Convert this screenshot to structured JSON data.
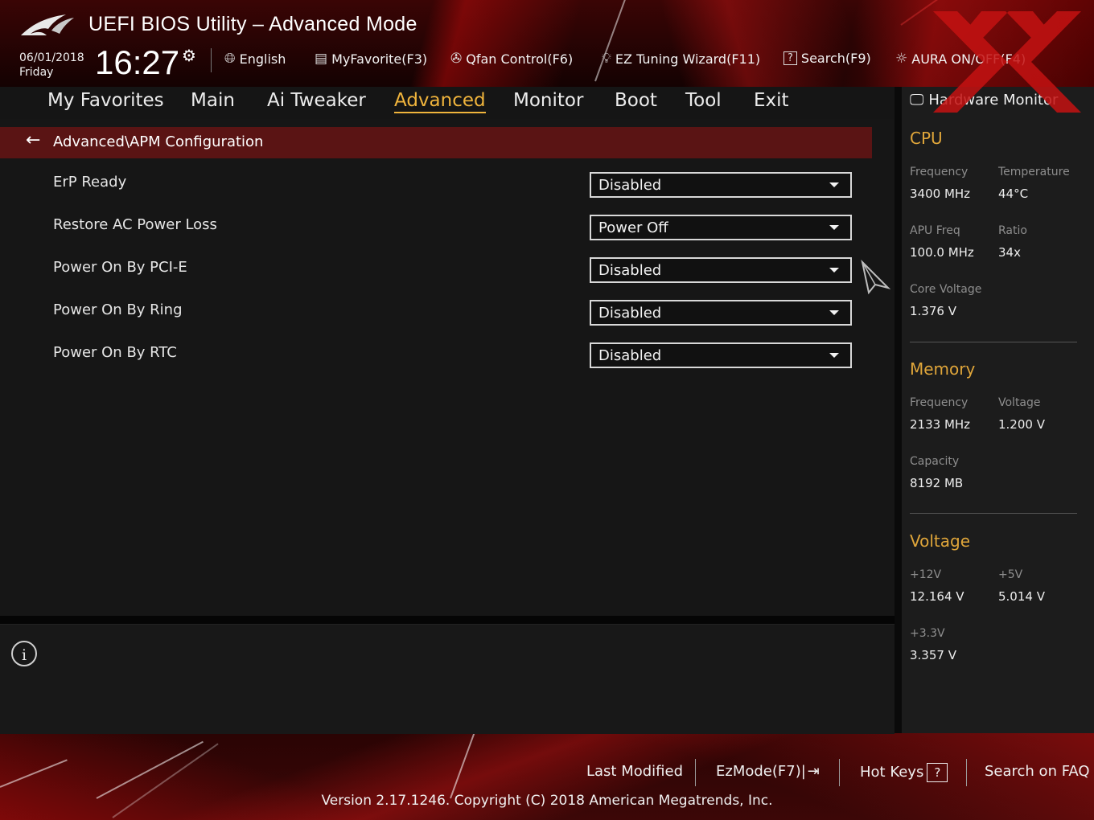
{
  "header": {
    "title": "UEFI BIOS Utility – Advanced Mode",
    "date": "06/01/2018",
    "day": "Friday",
    "time": "16:27",
    "tools": [
      {
        "icon": "globe-icon",
        "label": "English"
      },
      {
        "icon": "favorite-list-icon",
        "label": "MyFavorite(F3)"
      },
      {
        "icon": "fan-icon",
        "label": "Qfan Control(F6)"
      },
      {
        "icon": "lightbulb-icon",
        "label": "EZ Tuning Wizard(F11)"
      },
      {
        "icon": "question-box-icon",
        "label": "Search(F9)"
      },
      {
        "icon": "aura-light-icon",
        "label": "AURA ON/OFF(F4)"
      }
    ]
  },
  "nav": {
    "tabs": [
      "My Favorites",
      "Main",
      "Ai Tweaker",
      "Advanced",
      "Monitor",
      "Boot",
      "Tool",
      "Exit"
    ],
    "active": "Advanced"
  },
  "breadcrumb": "Advanced\\APM Configuration",
  "settings": [
    {
      "label": "ErP Ready",
      "value": "Disabled"
    },
    {
      "label": "Restore AC Power Loss",
      "value": "Power Off"
    },
    {
      "label": "Power On By PCI-E",
      "value": "Disabled"
    },
    {
      "label": "Power On By Ring",
      "value": "Disabled"
    },
    {
      "label": "Power On By RTC",
      "value": "Disabled"
    }
  ],
  "hardware_monitor": {
    "title": "Hardware Monitor",
    "cpu": {
      "heading": "CPU",
      "frequency_label": "Frequency",
      "frequency": "3400 MHz",
      "temperature_label": "Temperature",
      "temperature": "44°C",
      "apu_freq_label": "APU Freq",
      "apu_freq": "100.0 MHz",
      "ratio_label": "Ratio",
      "ratio": "34x",
      "core_voltage_label": "Core Voltage",
      "core_voltage": "1.376 V"
    },
    "memory": {
      "heading": "Memory",
      "frequency_label": "Frequency",
      "frequency": "2133 MHz",
      "voltage_label": "Voltage",
      "voltage": "1.200 V",
      "capacity_label": "Capacity",
      "capacity": "8192 MB"
    },
    "voltage": {
      "heading": "Voltage",
      "v12_label": "+12V",
      "v12": "12.164 V",
      "v5_label": "+5V",
      "v5": "5.014 V",
      "v33_label": "+3.3V",
      "v33": "3.357 V"
    }
  },
  "footer": {
    "last_modified": "Last Modified",
    "ezmode": "EzMode(F7)|",
    "hot_keys": "Hot Keys",
    "hot_keys_box": "?",
    "search_faq": "Search on FAQ",
    "version": "Version 2.17.1246. Copyright (C) 2018 American Megatrends, Inc."
  },
  "colors": {
    "accent": "#f0b43c",
    "section_heading": "#e0a63a",
    "breadcrumb_bg": "#5a1414",
    "brand_red": "#c00000"
  }
}
